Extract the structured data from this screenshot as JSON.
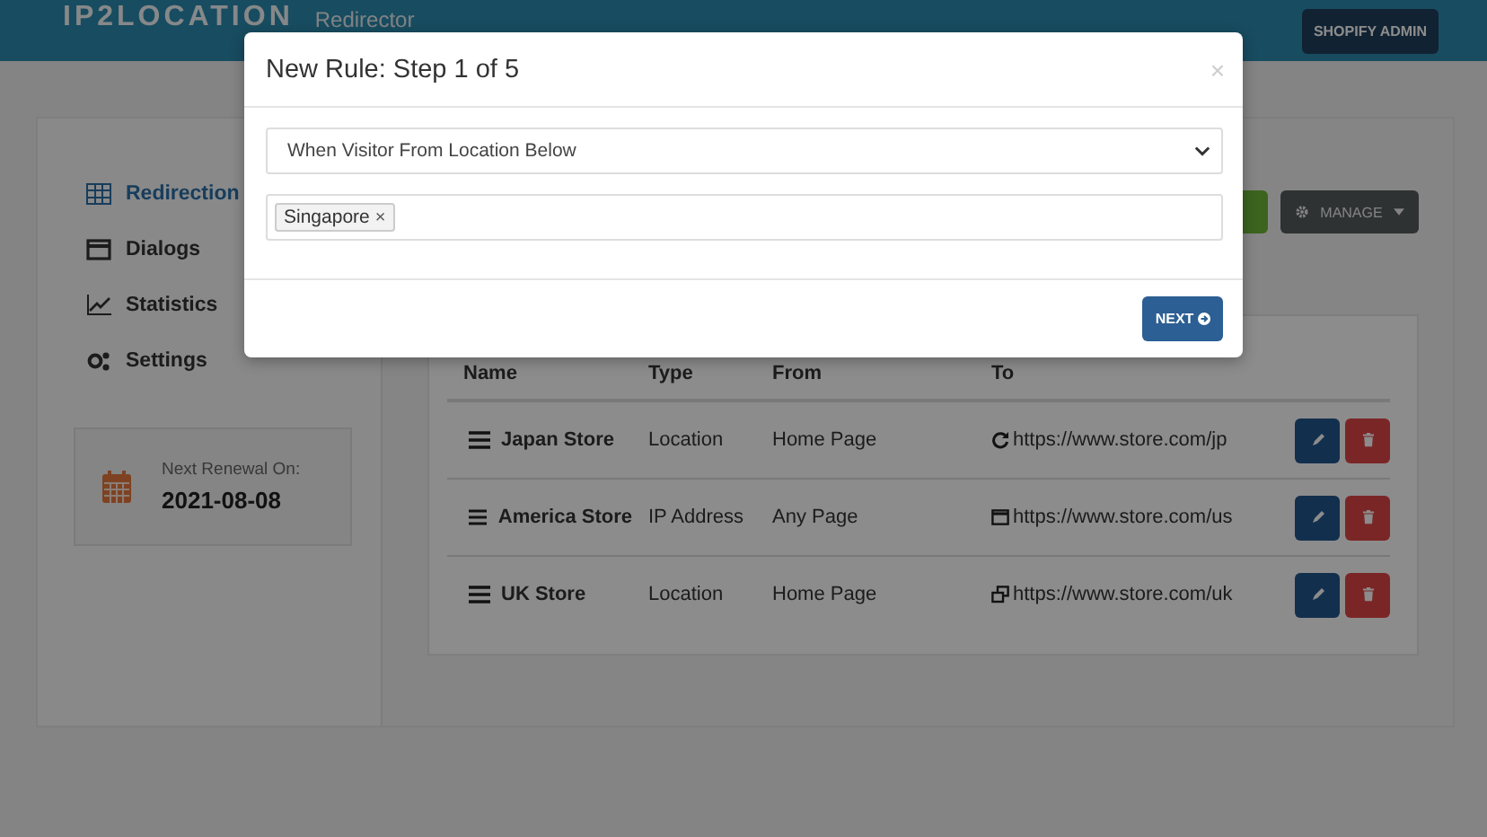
{
  "header": {
    "logo": "IP2LOCATION",
    "subtitle": "Redirector",
    "admin_button": "SHOPIFY ADMIN"
  },
  "sidebar": {
    "items": [
      {
        "label": "Redirection",
        "selected": true
      },
      {
        "label": "Dialogs",
        "selected": false
      },
      {
        "label": "Statistics",
        "selected": false
      },
      {
        "label": "Settings",
        "selected": false
      }
    ],
    "renewal": {
      "label": "Next Renewal On:",
      "date": "2021-08-08"
    }
  },
  "toolbar": {
    "manage_button": "MANAGE"
  },
  "table": {
    "columns": [
      "Name",
      "Type",
      "From",
      "To"
    ],
    "rows": [
      {
        "name": "Japan Store",
        "type": "Location",
        "from": "Home Page",
        "to": "https://www.store.com/jp"
      },
      {
        "name": "America Store",
        "type": "IP Address",
        "from": "Any Page",
        "to": "https://www.store.com/us"
      },
      {
        "name": "UK Store",
        "type": "Location",
        "from": "Home Page",
        "to": "https://www.store.com/uk"
      }
    ]
  },
  "modal": {
    "title": "New Rule: Step 1 of 5",
    "close": "×",
    "condition": "When Visitor From Location Below",
    "tags": [
      {
        "label": "Singapore",
        "remove": "×"
      }
    ],
    "next_button": "NEXT"
  }
}
